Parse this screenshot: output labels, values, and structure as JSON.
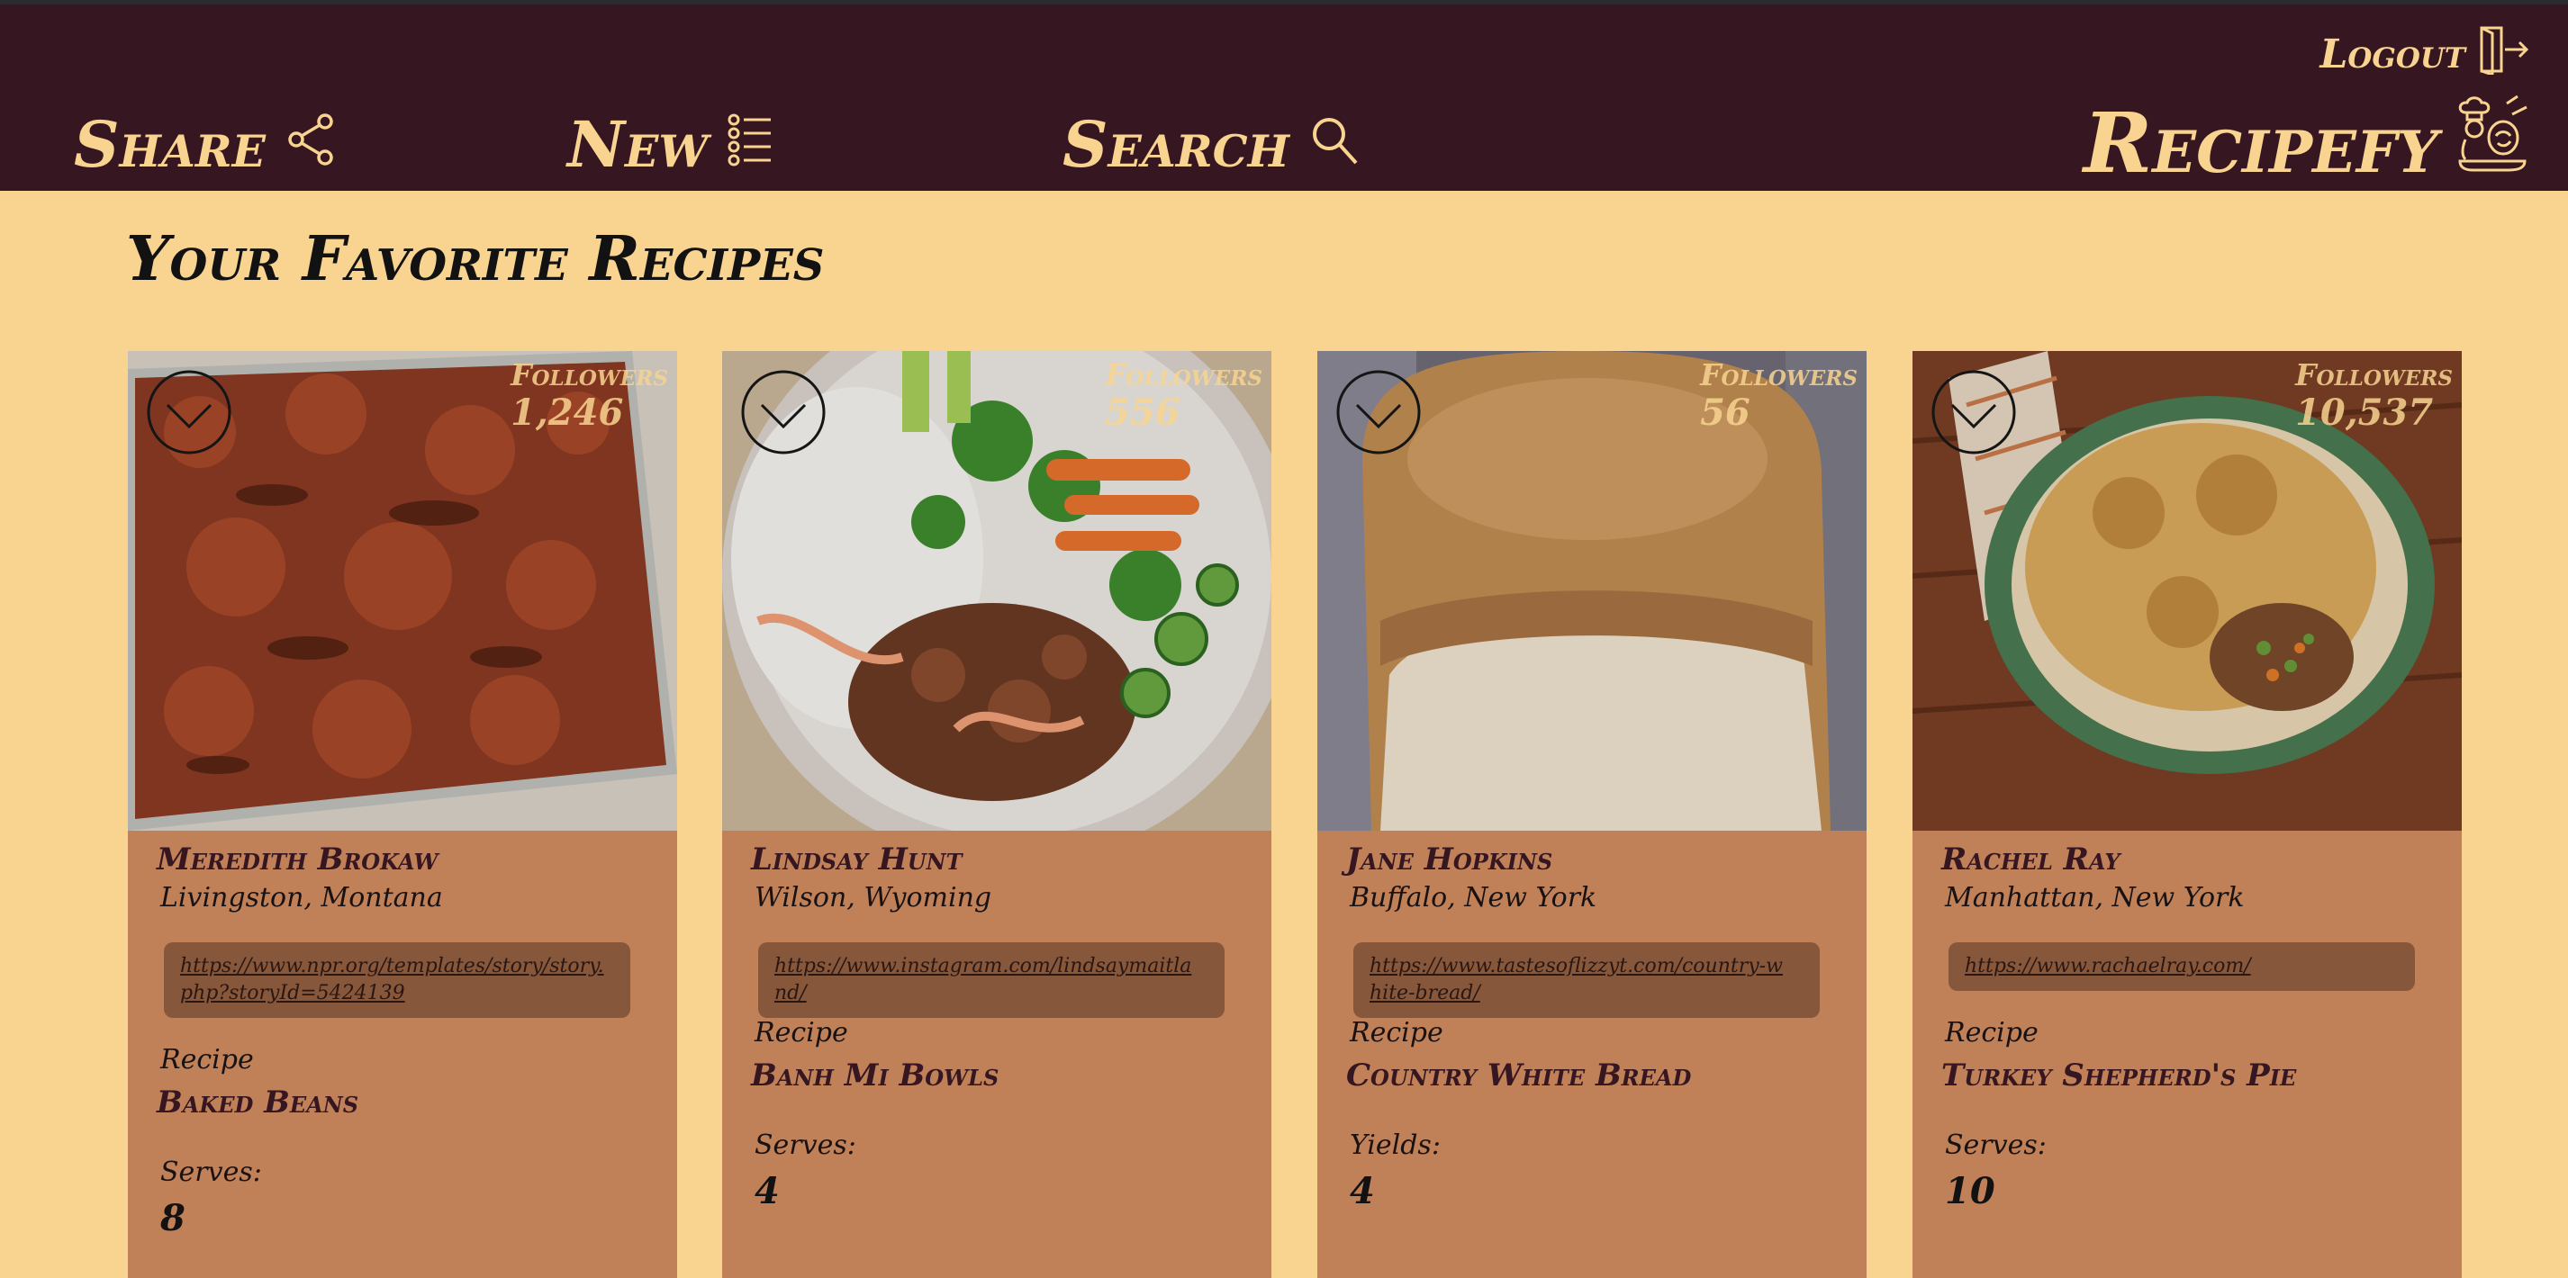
{
  "header": {
    "logout_label": "Logout",
    "nav": {
      "share_label": "Share",
      "new_label": "New",
      "search_label": "Search"
    },
    "brand": "Recipefy"
  },
  "main": {
    "title": "Your Favorite Recipes",
    "cards": [
      {
        "followers_label": "Followers",
        "followers": "1,246",
        "chef": "Meredith Brokaw",
        "location": "Livingston, Montana",
        "url": "https://www.npr.org/templates/story/story.php?storyId=5424139",
        "recipe_label": "Recipe",
        "recipe": "Baked Beans",
        "serves_label": "Serves:",
        "serves": "8"
      },
      {
        "followers_label": "Followers",
        "followers": "556",
        "chef": "Lindsay Hunt",
        "location": "Wilson, Wyoming",
        "url": "https://www.instagram.com/lindsaymaitland/",
        "recipe_label": "Recipe",
        "recipe": "Banh Mi Bowls",
        "serves_label": "Serves:",
        "serves": "4"
      },
      {
        "followers_label": "Followers",
        "followers": "56",
        "chef": "Jane Hopkins",
        "location": "Buffalo, New York",
        "url": "https://www.tastesoflizzyt.com/country-white-bread/",
        "recipe_label": "Recipe",
        "recipe": "Country White Bread",
        "serves_label": "Yields:",
        "serves": "4"
      },
      {
        "followers_label": "Followers",
        "followers": "10,537",
        "chef": "Rachel Ray",
        "location": "Manhattan, New York",
        "url": "https://www.rachaelray.com/",
        "recipe_label": "Recipe",
        "recipe": "Turkey Shepherd's Pie",
        "serves_label": "Serves:",
        "serves": "10"
      }
    ]
  },
  "colors": {
    "header_bg": "#361620",
    "accent": "#f8d490",
    "card_bg": "#c08058",
    "link_bg": "#86573a"
  },
  "icons": [
    "logout-icon",
    "share-icon",
    "list-icon",
    "search-icon",
    "chef-logo-icon",
    "chevron-down-icon"
  ]
}
